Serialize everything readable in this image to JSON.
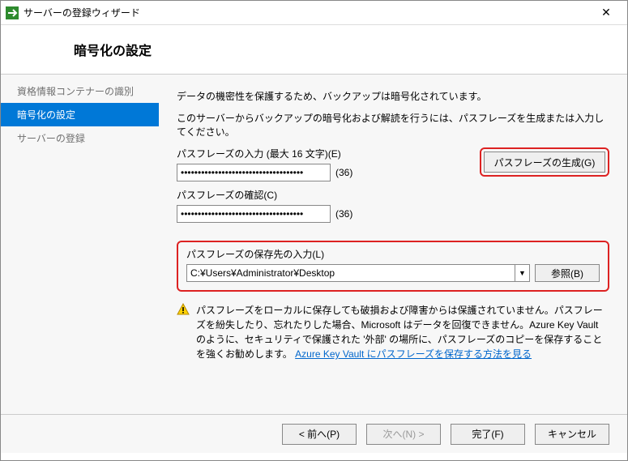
{
  "window": {
    "title": "サーバーの登録ウィザード"
  },
  "header": {
    "title": "暗号化の設定"
  },
  "sidebar": {
    "items": [
      {
        "label": "資格情報コンテナーの識別",
        "active": false
      },
      {
        "label": "暗号化の設定",
        "active": true
      },
      {
        "label": "サーバーの登録",
        "active": false
      }
    ]
  },
  "main": {
    "intro1": "データの機密性を保護するため、バックアップは暗号化されています。",
    "intro2": "このサーバーからバックアップの暗号化および解読を行うには、パスフレーズを生成または入力してください。",
    "pass_label": "パスフレーズの入力 (最大 16 文字)(E)",
    "pass_value": "************************************",
    "pass_count": "(36)",
    "confirm_label": "パスフレーズの確認(C)",
    "confirm_value": "************************************",
    "confirm_count": "(36)",
    "generate_button": "パスフレーズの生成(G)",
    "save_label": "パスフレーズの保存先の入力(L)",
    "save_path": "C:¥Users¥Administrator¥Desktop",
    "browse_button": "参照(B)",
    "warning_text": "パスフレーズをローカルに保存しても破損および障害からは保護されていません。パスフレーズを紛失したり、忘れたりした場合、Microsoft はデータを回復できません。Azure Key Vault のように、セキュリティで保護された '外部' の場所に、パスフレーズのコピーを保存することを強くお勧めします。",
    "warning_link": "Azure Key Vault にパスフレーズを保存する方法を見る"
  },
  "footer": {
    "prev": "< 前へ(P)",
    "next": "次へ(N) >",
    "finish": "完了(F)",
    "cancel": "キャンセル"
  }
}
